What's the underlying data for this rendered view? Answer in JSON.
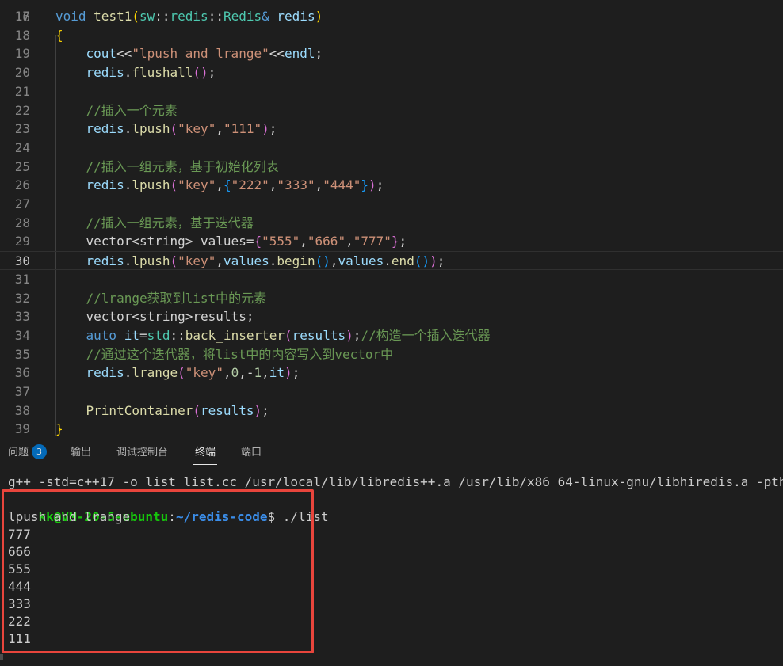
{
  "editor": {
    "first_line_partial": "16",
    "lines": [
      {
        "num": "17",
        "tokens": [
          [
            "kw",
            "void"
          ],
          [
            "op",
            " "
          ],
          [
            "fn",
            "test1"
          ],
          [
            "b1",
            "("
          ],
          [
            "ns",
            "sw"
          ],
          [
            "op",
            "::"
          ],
          [
            "ns",
            "redis"
          ],
          [
            "op",
            "::"
          ],
          [
            "ns",
            "Redis"
          ],
          [
            "kw",
            "&"
          ],
          [
            "op",
            " "
          ],
          [
            "var",
            "redis"
          ],
          [
            "b1",
            ")"
          ]
        ]
      },
      {
        "num": "18",
        "tokens": [
          [
            "b1",
            "{"
          ]
        ]
      },
      {
        "num": "19",
        "tokens": [
          [
            "op",
            "    "
          ],
          [
            "var",
            "cout"
          ],
          [
            "op",
            "<<"
          ],
          [
            "str",
            "\"lpush and lrange\""
          ],
          [
            "op",
            "<<"
          ],
          [
            "var",
            "endl"
          ],
          [
            "op",
            ";"
          ]
        ]
      },
      {
        "num": "20",
        "tokens": [
          [
            "op",
            "    "
          ],
          [
            "var",
            "redis"
          ],
          [
            "op",
            "."
          ],
          [
            "fn",
            "flushall"
          ],
          [
            "b2",
            "()"
          ],
          [
            "op",
            ";"
          ]
        ]
      },
      {
        "num": "21",
        "tokens": []
      },
      {
        "num": "22",
        "tokens": [
          [
            "op",
            "    "
          ],
          [
            "cm",
            "//插入一个元素"
          ]
        ]
      },
      {
        "num": "23",
        "tokens": [
          [
            "op",
            "    "
          ],
          [
            "var",
            "redis"
          ],
          [
            "op",
            "."
          ],
          [
            "fn",
            "lpush"
          ],
          [
            "b2",
            "("
          ],
          [
            "str",
            "\"key\""
          ],
          [
            "op",
            ","
          ],
          [
            "str",
            "\"111\""
          ],
          [
            "b2",
            ")"
          ],
          [
            "op",
            ";"
          ]
        ]
      },
      {
        "num": "24",
        "tokens": []
      },
      {
        "num": "25",
        "tokens": [
          [
            "op",
            "    "
          ],
          [
            "cm",
            "//插入一组元素，基于初始化列表"
          ]
        ]
      },
      {
        "num": "26",
        "tokens": [
          [
            "op",
            "    "
          ],
          [
            "var",
            "redis"
          ],
          [
            "op",
            "."
          ],
          [
            "fn",
            "lpush"
          ],
          [
            "b2",
            "("
          ],
          [
            "str",
            "\"key\""
          ],
          [
            "op",
            ","
          ],
          [
            "b3",
            "{"
          ],
          [
            "str",
            "\"222\""
          ],
          [
            "op",
            ","
          ],
          [
            "str",
            "\"333\""
          ],
          [
            "op",
            ","
          ],
          [
            "str",
            "\"444\""
          ],
          [
            "b3",
            "}"
          ],
          [
            "b2",
            ")"
          ],
          [
            "op",
            ";"
          ]
        ]
      },
      {
        "num": "27",
        "tokens": []
      },
      {
        "num": "28",
        "tokens": [
          [
            "op",
            "    "
          ],
          [
            "cm",
            "//插入一组元素，基于迭代器"
          ]
        ]
      },
      {
        "num": "29",
        "tokens": [
          [
            "op",
            "    "
          ],
          [
            "op",
            "vector<string> values="
          ],
          [
            "b2",
            "{"
          ],
          [
            "str",
            "\"555\""
          ],
          [
            "op",
            ","
          ],
          [
            "str",
            "\"666\""
          ],
          [
            "op",
            ","
          ],
          [
            "str",
            "\"777\""
          ],
          [
            "b2",
            "}"
          ],
          [
            "op",
            ";"
          ]
        ]
      },
      {
        "num": "30",
        "tokens": [
          [
            "op",
            "    "
          ],
          [
            "var",
            "redis"
          ],
          [
            "op",
            "."
          ],
          [
            "fn",
            "lpush"
          ],
          [
            "b2",
            "("
          ],
          [
            "str",
            "\"key\""
          ],
          [
            "op",
            ","
          ],
          [
            "var",
            "values"
          ],
          [
            "op",
            "."
          ],
          [
            "fn",
            "begin"
          ],
          [
            "b3",
            "()"
          ],
          [
            "op",
            ","
          ],
          [
            "var",
            "values"
          ],
          [
            "op",
            "."
          ],
          [
            "fn",
            "end"
          ],
          [
            "b3",
            "()"
          ],
          [
            "b2",
            ")"
          ],
          [
            "op",
            ";"
          ]
        ],
        "current": true
      },
      {
        "num": "31",
        "tokens": []
      },
      {
        "num": "32",
        "tokens": [
          [
            "op",
            "    "
          ],
          [
            "cm",
            "//lrange获取到list中的元素"
          ]
        ]
      },
      {
        "num": "33",
        "tokens": [
          [
            "op",
            "    "
          ],
          [
            "op",
            "vector<string>results;"
          ]
        ]
      },
      {
        "num": "34",
        "tokens": [
          [
            "op",
            "    "
          ],
          [
            "kw",
            "auto"
          ],
          [
            "op",
            " "
          ],
          [
            "var",
            "it"
          ],
          [
            "op",
            "="
          ],
          [
            "ns",
            "std"
          ],
          [
            "op",
            "::"
          ],
          [
            "fn",
            "back_inserter"
          ],
          [
            "b2",
            "("
          ],
          [
            "var",
            "results"
          ],
          [
            "b2",
            ")"
          ],
          [
            "op",
            ";"
          ],
          [
            "cm",
            "//构造一个插入迭代器"
          ]
        ]
      },
      {
        "num": "35",
        "tokens": [
          [
            "op",
            "    "
          ],
          [
            "cm",
            "//通过这个迭代器，将list中的内容写入到vector中"
          ]
        ]
      },
      {
        "num": "36",
        "tokens": [
          [
            "op",
            "    "
          ],
          [
            "var",
            "redis"
          ],
          [
            "op",
            "."
          ],
          [
            "fn",
            "lrange"
          ],
          [
            "b2",
            "("
          ],
          [
            "str",
            "\"key\""
          ],
          [
            "op",
            ","
          ],
          [
            "num",
            "0"
          ],
          [
            "op",
            ",-"
          ],
          [
            "num",
            "1"
          ],
          [
            "op",
            ","
          ],
          [
            "var",
            "it"
          ],
          [
            "b2",
            ")"
          ],
          [
            "op",
            ";"
          ]
        ]
      },
      {
        "num": "37",
        "tokens": []
      },
      {
        "num": "38",
        "tokens": [
          [
            "op",
            "    "
          ],
          [
            "fn",
            "PrintContainer"
          ],
          [
            "b2",
            "("
          ],
          [
            "var",
            "results"
          ],
          [
            "b2",
            ")"
          ],
          [
            "op",
            ";"
          ]
        ]
      },
      {
        "num": "39",
        "tokens": [
          [
            "b1",
            "}"
          ]
        ]
      }
    ]
  },
  "panel": {
    "tabs": [
      {
        "label": "问题",
        "badge": "3"
      },
      {
        "label": "输出"
      },
      {
        "label": "调试控制台"
      },
      {
        "label": "终端",
        "active": true
      },
      {
        "label": "端口"
      }
    ]
  },
  "terminal": {
    "compile_cmd": "g++ -std=c++17 -o list list.cc /usr/local/lib/libredis++.a /usr/lib/x86_64-linux-gnu/libhiredis.a -pthread",
    "prompt_user": "kk@VM-20-5-ubuntu",
    "prompt_sep": ":",
    "prompt_path": "~/redis-code",
    "prompt_dollar": "$ ",
    "run_cmd": "./list",
    "output": [
      "lpush and lrange",
      "777",
      "666",
      "555",
      "444",
      "333",
      "222",
      "111"
    ]
  },
  "colors": {
    "highlight_box": "#e8453c",
    "badge": "#0078d4"
  }
}
